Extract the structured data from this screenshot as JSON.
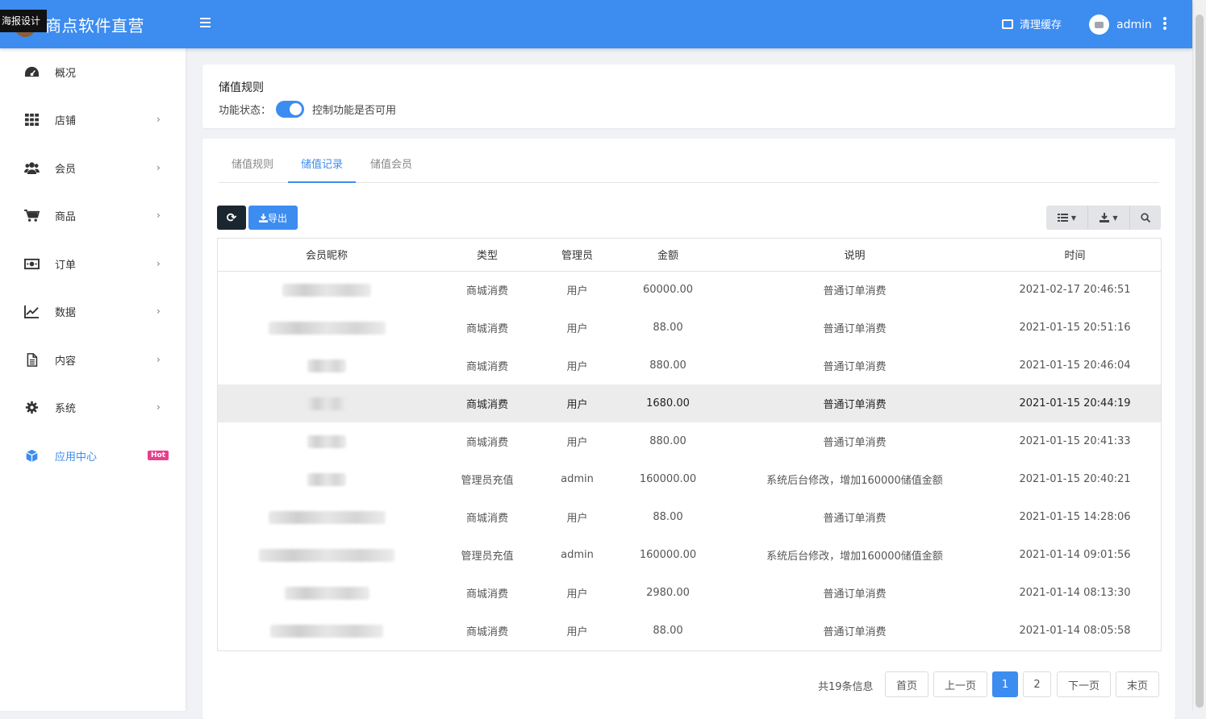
{
  "tooltip": "海报设计",
  "brand": {
    "title": "商点软件直营"
  },
  "header": {
    "clear_cache": "清理缓存",
    "username": "admin"
  },
  "sidebar": {
    "items": [
      {
        "label": "概况",
        "icon": "dashboard-icon",
        "arrow": ""
      },
      {
        "label": "店铺",
        "icon": "grid-icon",
        "arrow": "›"
      },
      {
        "label": "会员",
        "icon": "users-icon",
        "arrow": "›"
      },
      {
        "label": "商品",
        "icon": "cart-icon",
        "arrow": "›"
      },
      {
        "label": "订单",
        "icon": "money-icon",
        "arrow": "›"
      },
      {
        "label": "数据",
        "icon": "line-chart-icon",
        "arrow": "›"
      },
      {
        "label": "内容",
        "icon": "document-icon",
        "arrow": "›"
      },
      {
        "label": "系统",
        "icon": "gear-icon",
        "arrow": "›"
      },
      {
        "label": "应用中心",
        "icon": "cube-icon",
        "arrow": "",
        "badge": "Hot"
      }
    ]
  },
  "rules_card": {
    "title": "储值规则",
    "status_label": "功能状态：",
    "status_desc": "控制功能是否可用"
  },
  "tabs": [
    "储值规则",
    "储值记录",
    "储值会员"
  ],
  "toolbar": {
    "export": "导出"
  },
  "table": {
    "headers": [
      "会员昵称",
      "类型",
      "管理员",
      "金额",
      "说明",
      "时间"
    ],
    "rows": [
      {
        "type": "商城消费",
        "admin": "用户",
        "amount": "60000.00",
        "desc": "普通订单消费",
        "time": "2021-02-17 20:46:51"
      },
      {
        "type": "商城消费",
        "admin": "用户",
        "amount": "88.00",
        "desc": "普通订单消费",
        "time": "2021-01-15 20:51:16"
      },
      {
        "type": "商城消费",
        "admin": "用户",
        "amount": "880.00",
        "desc": "普通订单消费",
        "time": "2021-01-15 20:46:04"
      },
      {
        "type": "商城消费",
        "admin": "用户",
        "amount": "1680.00",
        "desc": "普通订单消费",
        "time": "2021-01-15 20:44:19"
      },
      {
        "type": "商城消费",
        "admin": "用户",
        "amount": "880.00",
        "desc": "普通订单消费",
        "time": "2021-01-15 20:41:33"
      },
      {
        "type": "管理员充值",
        "admin": "admin",
        "amount": "160000.00",
        "desc": "系统后台修改，增加160000储值金额",
        "time": "2021-01-15 20:40:21"
      },
      {
        "type": "商城消费",
        "admin": "用户",
        "amount": "88.00",
        "desc": "普通订单消费",
        "time": "2021-01-15 14:28:06"
      },
      {
        "type": "管理员充值",
        "admin": "admin",
        "amount": "160000.00",
        "desc": "系统后台修改，增加160000储值金额",
        "time": "2021-01-14 09:01:56"
      },
      {
        "type": "商城消费",
        "admin": "用户",
        "amount": "2980.00",
        "desc": "普通订单消费",
        "time": "2021-01-14 08:13:30"
      },
      {
        "type": "商城消费",
        "admin": "用户",
        "amount": "88.00",
        "desc": "普通订单消费",
        "time": "2021-01-14 08:05:58"
      }
    ]
  },
  "pagination": {
    "info": "共19条信息",
    "first": "首页",
    "prev": "上一页",
    "pages": [
      "1",
      "2"
    ],
    "next": "下一页",
    "last": "末页"
  }
}
